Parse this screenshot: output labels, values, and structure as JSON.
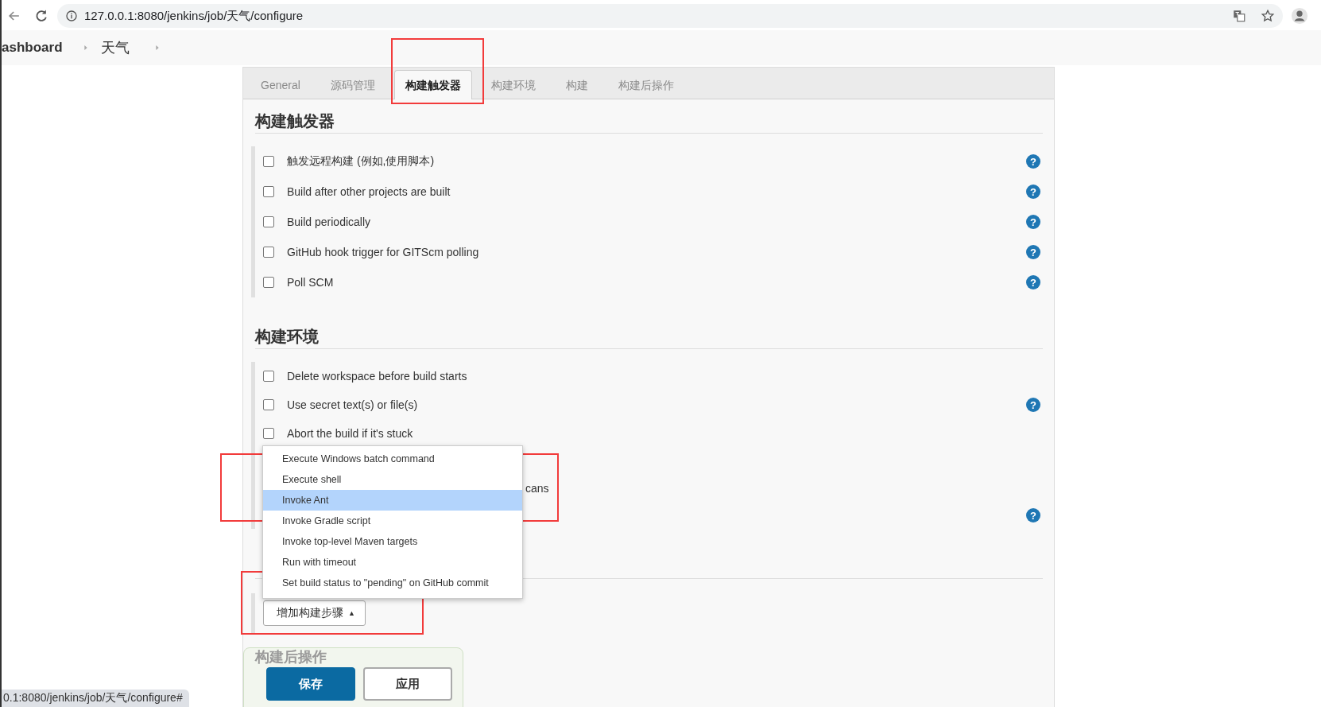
{
  "browser": {
    "url": "127.0.0.1:8080/jenkins/job/天气/configure"
  },
  "breadcrumbs": [
    "ashboard",
    "天气"
  ],
  "tabs": [
    {
      "label": "General",
      "selected": false
    },
    {
      "label": "源码管理",
      "selected": false
    },
    {
      "label": "构建触发器",
      "selected": true
    },
    {
      "label": "构建环境",
      "selected": false
    },
    {
      "label": "构建",
      "selected": false
    },
    {
      "label": "构建后操作",
      "selected": false
    }
  ],
  "sections": [
    {
      "title": "构建触发器",
      "options": [
        {
          "kind": "checkbox",
          "label": "触发远程构建 (例如,使用脚本)",
          "checked": false,
          "help": "?"
        },
        {
          "kind": "checkbox",
          "label": "Build after other projects are built",
          "checked": false,
          "help": "?"
        },
        {
          "kind": "checkbox",
          "label": "Build periodically",
          "checked": false,
          "help": "?"
        },
        {
          "kind": "checkbox",
          "label": "GitHub hook trigger for GITScm polling",
          "checked": false,
          "help": "?"
        },
        {
          "kind": "checkbox",
          "label": "Poll SCM",
          "checked": false,
          "help": "?"
        }
      ]
    },
    {
      "title": "构建环境",
      "options": [
        {
          "kind": "checkbox",
          "label": "Delete workspace before build starts",
          "checked": false
        },
        {
          "kind": "checkbox",
          "label": "Use secret text(s) or file(s)",
          "checked": false,
          "help": "?"
        },
        {
          "kind": "checkbox",
          "label": "Abort the build if it's stuck",
          "checked": false
        },
        {
          "kind": "blank"
        },
        {
          "kind": "fragment",
          "label": "cans"
        },
        {
          "kind": "blank",
          "help": "?"
        }
      ]
    }
  ],
  "add_step_button": {
    "label": "增加构建步骤",
    "caret": "▲"
  },
  "step_menu": {
    "items": [
      {
        "label": "Execute Windows batch command",
        "selected": false
      },
      {
        "label": "Execute shell",
        "selected": false
      },
      {
        "label": "Invoke Ant",
        "selected": true
      },
      {
        "label": "Invoke Gradle script",
        "selected": false
      },
      {
        "label": "Invoke top-level Maven targets",
        "selected": false
      },
      {
        "label": "Run with timeout",
        "selected": false
      },
      {
        "label": "Set build status to \"pending\" on GitHub commit",
        "selected": false
      }
    ]
  },
  "post_build": {
    "title": "构建后操作"
  },
  "save_bar": {
    "save": "保存",
    "apply": "应用"
  },
  "status_url": "0.1:8080/jenkins/job/天气/configure#"
}
